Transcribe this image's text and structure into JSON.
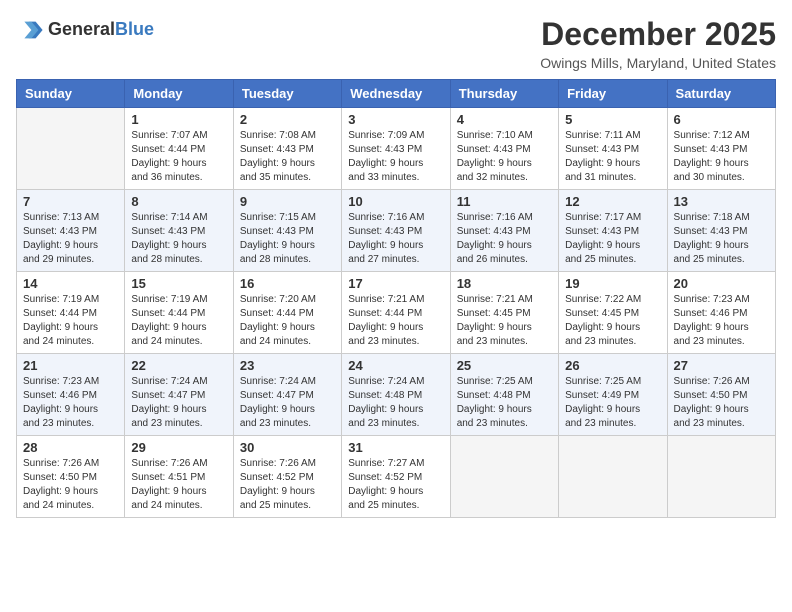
{
  "header": {
    "logo_general": "General",
    "logo_blue": "Blue",
    "month_title": "December 2025",
    "location": "Owings Mills, Maryland, United States"
  },
  "days_of_week": [
    "Sunday",
    "Monday",
    "Tuesday",
    "Wednesday",
    "Thursday",
    "Friday",
    "Saturday"
  ],
  "weeks": [
    [
      {
        "day": "",
        "info": ""
      },
      {
        "day": "1",
        "info": "Sunrise: 7:07 AM\nSunset: 4:44 PM\nDaylight: 9 hours\nand 36 minutes."
      },
      {
        "day": "2",
        "info": "Sunrise: 7:08 AM\nSunset: 4:43 PM\nDaylight: 9 hours\nand 35 minutes."
      },
      {
        "day": "3",
        "info": "Sunrise: 7:09 AM\nSunset: 4:43 PM\nDaylight: 9 hours\nand 33 minutes."
      },
      {
        "day": "4",
        "info": "Sunrise: 7:10 AM\nSunset: 4:43 PM\nDaylight: 9 hours\nand 32 minutes."
      },
      {
        "day": "5",
        "info": "Sunrise: 7:11 AM\nSunset: 4:43 PM\nDaylight: 9 hours\nand 31 minutes."
      },
      {
        "day": "6",
        "info": "Sunrise: 7:12 AM\nSunset: 4:43 PM\nDaylight: 9 hours\nand 30 minutes."
      }
    ],
    [
      {
        "day": "7",
        "info": "Sunrise: 7:13 AM\nSunset: 4:43 PM\nDaylight: 9 hours\nand 29 minutes."
      },
      {
        "day": "8",
        "info": "Sunrise: 7:14 AM\nSunset: 4:43 PM\nDaylight: 9 hours\nand 28 minutes."
      },
      {
        "day": "9",
        "info": "Sunrise: 7:15 AM\nSunset: 4:43 PM\nDaylight: 9 hours\nand 28 minutes."
      },
      {
        "day": "10",
        "info": "Sunrise: 7:16 AM\nSunset: 4:43 PM\nDaylight: 9 hours\nand 27 minutes."
      },
      {
        "day": "11",
        "info": "Sunrise: 7:16 AM\nSunset: 4:43 PM\nDaylight: 9 hours\nand 26 minutes."
      },
      {
        "day": "12",
        "info": "Sunrise: 7:17 AM\nSunset: 4:43 PM\nDaylight: 9 hours\nand 25 minutes."
      },
      {
        "day": "13",
        "info": "Sunrise: 7:18 AM\nSunset: 4:43 PM\nDaylight: 9 hours\nand 25 minutes."
      }
    ],
    [
      {
        "day": "14",
        "info": "Sunrise: 7:19 AM\nSunset: 4:44 PM\nDaylight: 9 hours\nand 24 minutes."
      },
      {
        "day": "15",
        "info": "Sunrise: 7:19 AM\nSunset: 4:44 PM\nDaylight: 9 hours\nand 24 minutes."
      },
      {
        "day": "16",
        "info": "Sunrise: 7:20 AM\nSunset: 4:44 PM\nDaylight: 9 hours\nand 24 minutes."
      },
      {
        "day": "17",
        "info": "Sunrise: 7:21 AM\nSunset: 4:44 PM\nDaylight: 9 hours\nand 23 minutes."
      },
      {
        "day": "18",
        "info": "Sunrise: 7:21 AM\nSunset: 4:45 PM\nDaylight: 9 hours\nand 23 minutes."
      },
      {
        "day": "19",
        "info": "Sunrise: 7:22 AM\nSunset: 4:45 PM\nDaylight: 9 hours\nand 23 minutes."
      },
      {
        "day": "20",
        "info": "Sunrise: 7:23 AM\nSunset: 4:46 PM\nDaylight: 9 hours\nand 23 minutes."
      }
    ],
    [
      {
        "day": "21",
        "info": "Sunrise: 7:23 AM\nSunset: 4:46 PM\nDaylight: 9 hours\nand 23 minutes."
      },
      {
        "day": "22",
        "info": "Sunrise: 7:24 AM\nSunset: 4:47 PM\nDaylight: 9 hours\nand 23 minutes."
      },
      {
        "day": "23",
        "info": "Sunrise: 7:24 AM\nSunset: 4:47 PM\nDaylight: 9 hours\nand 23 minutes."
      },
      {
        "day": "24",
        "info": "Sunrise: 7:24 AM\nSunset: 4:48 PM\nDaylight: 9 hours\nand 23 minutes."
      },
      {
        "day": "25",
        "info": "Sunrise: 7:25 AM\nSunset: 4:48 PM\nDaylight: 9 hours\nand 23 minutes."
      },
      {
        "day": "26",
        "info": "Sunrise: 7:25 AM\nSunset: 4:49 PM\nDaylight: 9 hours\nand 23 minutes."
      },
      {
        "day": "27",
        "info": "Sunrise: 7:26 AM\nSunset: 4:50 PM\nDaylight: 9 hours\nand 23 minutes."
      }
    ],
    [
      {
        "day": "28",
        "info": "Sunrise: 7:26 AM\nSunset: 4:50 PM\nDaylight: 9 hours\nand 24 minutes."
      },
      {
        "day": "29",
        "info": "Sunrise: 7:26 AM\nSunset: 4:51 PM\nDaylight: 9 hours\nand 24 minutes."
      },
      {
        "day": "30",
        "info": "Sunrise: 7:26 AM\nSunset: 4:52 PM\nDaylight: 9 hours\nand 25 minutes."
      },
      {
        "day": "31",
        "info": "Sunrise: 7:27 AM\nSunset: 4:52 PM\nDaylight: 9 hours\nand 25 minutes."
      },
      {
        "day": "",
        "info": ""
      },
      {
        "day": "",
        "info": ""
      },
      {
        "day": "",
        "info": ""
      }
    ]
  ]
}
